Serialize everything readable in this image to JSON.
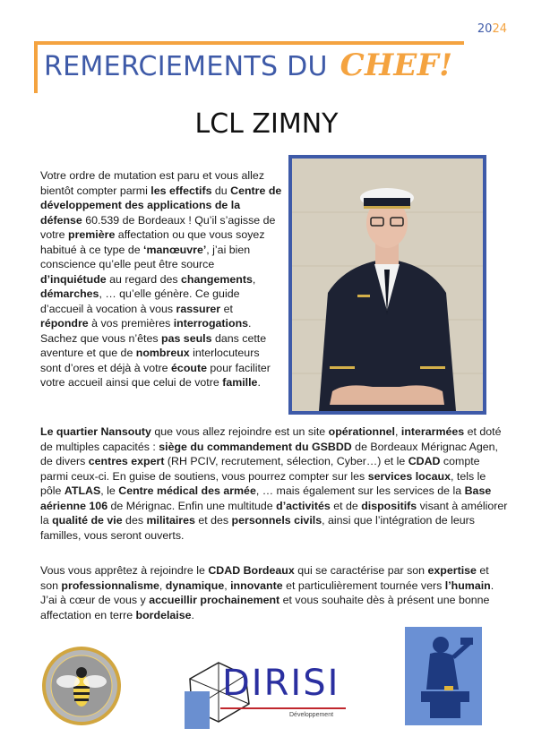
{
  "header": {
    "year_a": "20",
    "year_b": "24",
    "title_main": "REMERCIEMENTS DU",
    "title_accent": "CHEF!"
  },
  "name": "LCL ZIMNY",
  "p1": [
    {
      "t": "Votre ordre de mutation est paru et vous allez bientôt compter parmi "
    },
    {
      "b": "les effectifs"
    },
    {
      "t": " du "
    },
    {
      "b": "Centre de développement des applications de la défense"
    },
    {
      "t": " 60.539 de Bordeaux ! Qu’il s’agisse de votre "
    },
    {
      "b": "première"
    },
    {
      "t": " affectation ou que vous soyez habitué à ce type de "
    },
    {
      "b": "‘manœuvre’"
    },
    {
      "t": ", j’ai bien conscience qu’elle peut être source "
    },
    {
      "b": "d’inquiétude"
    },
    {
      "t": " au regard des "
    },
    {
      "b": "changements"
    },
    {
      "t": ", "
    },
    {
      "b": "démarches"
    },
    {
      "t": ", … qu’elle génère. Ce guide d’accueil à vocation à vous "
    },
    {
      "b": "rassurer"
    },
    {
      "t": " et "
    },
    {
      "b": "répondre"
    },
    {
      "t": " à vos premières "
    },
    {
      "b": "interrogations"
    },
    {
      "t": ". Sachez que vous n’êtes "
    },
    {
      "b": "pas seuls"
    },
    {
      "t": " dans cette aventure et que de "
    },
    {
      "b": "nombreux"
    },
    {
      "t": " interlocuteurs sont d’ores et déjà à votre "
    },
    {
      "b": "écoute"
    },
    {
      "t": " pour faciliter votre accueil ainsi que celui de votre "
    },
    {
      "b": "famille"
    },
    {
      "t": "."
    }
  ],
  "p2": [
    {
      "b": "Le quartier Nansouty"
    },
    {
      "t": " que vous allez rejoindre est un site "
    },
    {
      "b": "opérationnel"
    },
    {
      "t": ", "
    },
    {
      "b": "interarmées"
    },
    {
      "t": " et doté de multiples capacités : "
    },
    {
      "b": "siège du commandement du GSBDD"
    },
    {
      "t": " de Bordeaux Mérignac Agen, de divers "
    },
    {
      "b": "centres expert"
    },
    {
      "t": " (RH PCIV, recrutement, sélection, Cyber…) et le "
    },
    {
      "b": "CDAD"
    },
    {
      "t": " compte parmi ceux-ci. En guise de soutiens, vous pourrez compter sur les "
    },
    {
      "b": "services locaux"
    },
    {
      "t": ", tels le pôle "
    },
    {
      "b": "ATLAS"
    },
    {
      "t": ", le "
    },
    {
      "b": "Centre médical des armée"
    },
    {
      "t": ", … mais également sur les services de la "
    },
    {
      "b": "Base aérienne 106"
    },
    {
      "t": " de Mérignac. Enfin une multitude "
    },
    {
      "b": "d’activités"
    },
    {
      "t": " et de "
    },
    {
      "b": "dispositifs"
    },
    {
      "t": " visant à améliorer la "
    },
    {
      "b": "qualité de vie"
    },
    {
      "t": " des "
    },
    {
      "b": "militaires"
    },
    {
      "t": " et des "
    },
    {
      "b": "personnels civils"
    },
    {
      "t": ", ainsi que l’intégration de leurs familles, vous seront ouverts."
    }
  ],
  "p3": [
    {
      "t": "Vous vous apprêtez à rejoindre le "
    },
    {
      "b": "CDAD Bordeaux"
    },
    {
      "t": " qui se caractérise  par son "
    },
    {
      "b": "expertise"
    },
    {
      "t": " et son "
    },
    {
      "b": "professionnalisme"
    },
    {
      "t": ", "
    },
    {
      "b": "dynamique"
    },
    {
      "t": ", "
    },
    {
      "b": "innovante"
    },
    {
      "t": " et particulièrement tournée vers "
    },
    {
      "b": "l’humain"
    },
    {
      "t": ". J’ai à cœur de vous y "
    },
    {
      "b": "accueillir prochainement"
    },
    {
      "t": " et vous souhaite dès à présent une bonne affectation en terre "
    },
    {
      "b": "bordelaise"
    },
    {
      "t": "."
    }
  ],
  "footer": {
    "logo_text": "DIRISI",
    "logo_sub": "Développement"
  },
  "colors": {
    "blue": "#3e5aa8",
    "orange": "#f4a340"
  }
}
